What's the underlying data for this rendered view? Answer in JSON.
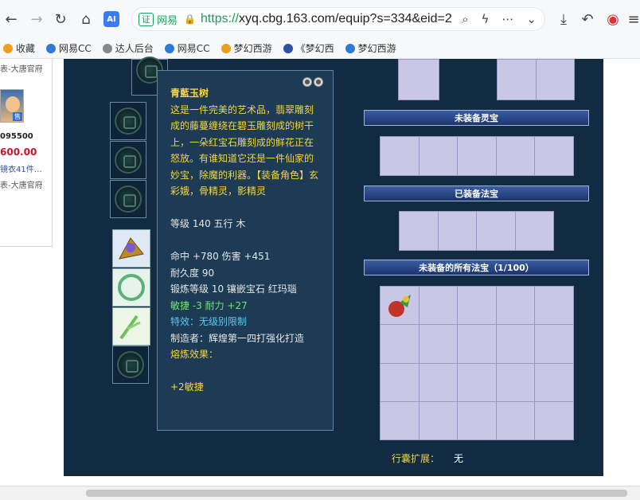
{
  "browser": {
    "cert_label": "证",
    "site_label": "网易",
    "url_proto": "https://",
    "url_rest": "xyq.cbg.163.com/equip?s=334&eid=2",
    "ai_label": "AI"
  },
  "bookmarks": [
    {
      "label": "收藏",
      "color": "#f0a020"
    },
    {
      "label": "网易CC",
      "color": "#2f7ad8"
    },
    {
      "label": "达人后台",
      "color": "#888888"
    },
    {
      "label": "网易CC",
      "color": "#2f7ad8"
    },
    {
      "label": "梦幻西游",
      "color": "#e8a020"
    },
    {
      "label": "《梦幻西",
      "color": "#3050a0"
    },
    {
      "label": "梦幻西游",
      "color": "#2f7ad8"
    }
  ],
  "leftcol": {
    "line1": "表-大唐官府",
    "id": "095500",
    "price": "600.00",
    "link": "镜衣41件…",
    "line2": "表-大唐官府",
    "badge": "售"
  },
  "tooltip": {
    "title": "青藍玉树",
    "description": "这是一件完美的艺术品，翡翠雕刻成的藤蔓缠绕在碧玉雕刻成的树干上，一朵红宝石雕刻成的鲜花正在怒放。有谁知道它还是一件仙家的妙宝，除魔的利器。【装备角色】玄彩娥，骨精灵，影精灵",
    "level": "等级 140 五行 木",
    "hit": "命中 +780 伤害 +451",
    "durability": "耐久度 90",
    "forge": "锻炼等级 10 镶嵌宝石 红玛瑙",
    "agility": "敏捷 -3 耐力 +27",
    "effect": "特效：无级别限制",
    "maker": "制造者：辉煌第一四打强化打造",
    "smelt": "熔炼效果：",
    "bonus": "+2敏捷"
  },
  "panel": {
    "bar_unequipped_lingbao": "未装备灵宝",
    "bar_equipped_fabao": "已装备法宝",
    "bar_all_fabao": "未装备的所有法宝（1/100）",
    "expand_label": "行囊扩展：",
    "expand_value": "无"
  }
}
